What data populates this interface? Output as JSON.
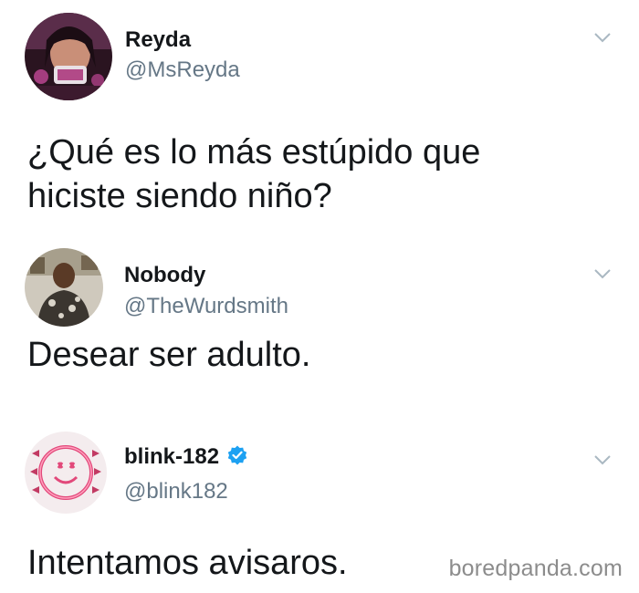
{
  "tweets": [
    {
      "name": "Reyda",
      "handle": "@MsReyda",
      "text_lines": [
        "¿Qué es lo más estúpido que",
        "hiciste siendo niño?"
      ],
      "avatar_icon": "profile-photo-icon",
      "menu_icon": "chevron-down-icon"
    },
    {
      "name": "Nobody",
      "handle": "@TheWurdsmith",
      "text_lines": [
        "Desear ser adulto."
      ],
      "avatar_icon": "profile-photo-icon",
      "menu_icon": "chevron-down-icon"
    },
    {
      "name": "blink-182",
      "handle": "@blink182",
      "text_lines": [
        "Intentamos avisaros."
      ],
      "avatar_icon": "smiley-logo-icon",
      "verified_icon": "verified-badge-icon",
      "menu_icon": "chevron-down-icon"
    }
  ],
  "watermark": "boredpanda.com",
  "colors": {
    "name": "#14171a",
    "handle": "#657786",
    "verified": "#1da1f2",
    "watermark": "#8c8c8c"
  }
}
